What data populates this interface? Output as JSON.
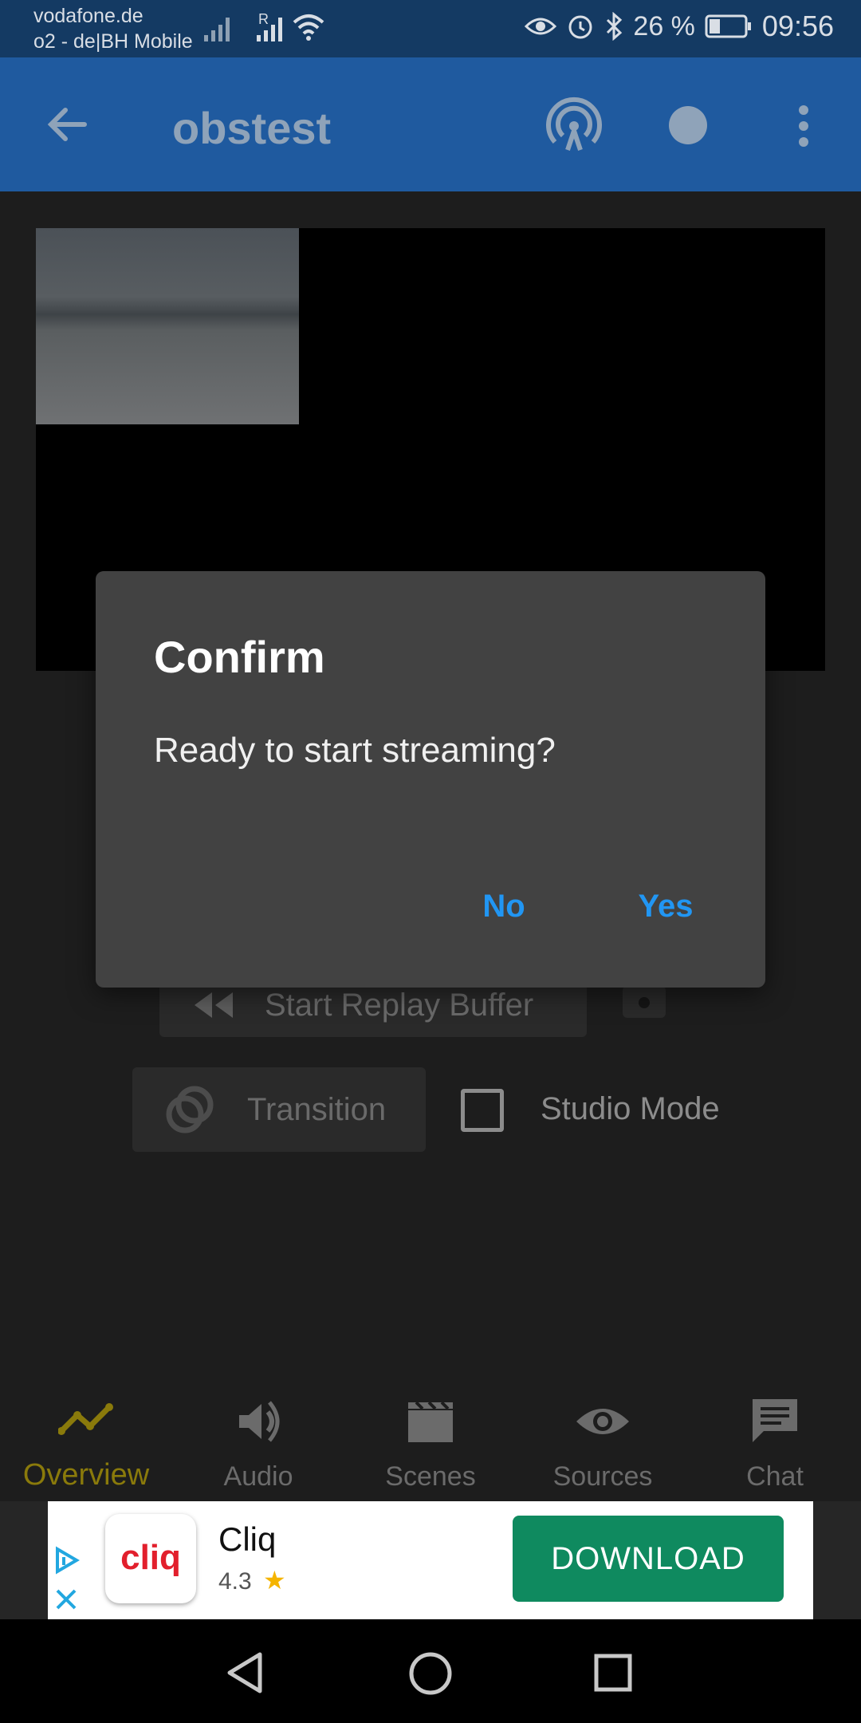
{
  "status_bar": {
    "carrier_primary": "vodafone.de",
    "carrier_secondary": "o2 - de|BH Mobile",
    "roaming_indicator": "R",
    "battery_percent": "26 %",
    "time": "09:56",
    "icons": [
      "signal-icon",
      "wifi-icon",
      "eye-icon",
      "alarm-icon",
      "bluetooth-icon",
      "battery-icon"
    ]
  },
  "app_bar": {
    "title": "obstest",
    "icons": [
      "back-arrow-icon",
      "broadcast-icon",
      "record-dot-icon",
      "more-vert-icon"
    ]
  },
  "controls": {
    "replay_label": "Start Replay Buffer",
    "transition_label": "Transition",
    "studio_mode_label": "Studio Mode"
  },
  "dialog": {
    "title": "Confirm",
    "message": "Ready to start streaming?",
    "no_label": "No",
    "yes_label": "Yes",
    "accent": "#2196f3"
  },
  "bottom_nav": {
    "items": [
      {
        "label": "Overview",
        "icon": "trending-icon",
        "active": true
      },
      {
        "label": "Audio",
        "icon": "speaker-icon",
        "active": false
      },
      {
        "label": "Scenes",
        "icon": "clapperboard-icon",
        "active": false
      },
      {
        "label": "Sources",
        "icon": "eye-icon",
        "active": false
      },
      {
        "label": "Chat",
        "icon": "chat-bubble-icon",
        "active": false
      }
    ],
    "active_color": "#8a7a0b"
  },
  "ad": {
    "logo_text": "cliq",
    "app_name": "Cliq",
    "rating": "4.3",
    "cta_label": "DOWNLOAD",
    "cta_color": "#0f8a5f"
  }
}
